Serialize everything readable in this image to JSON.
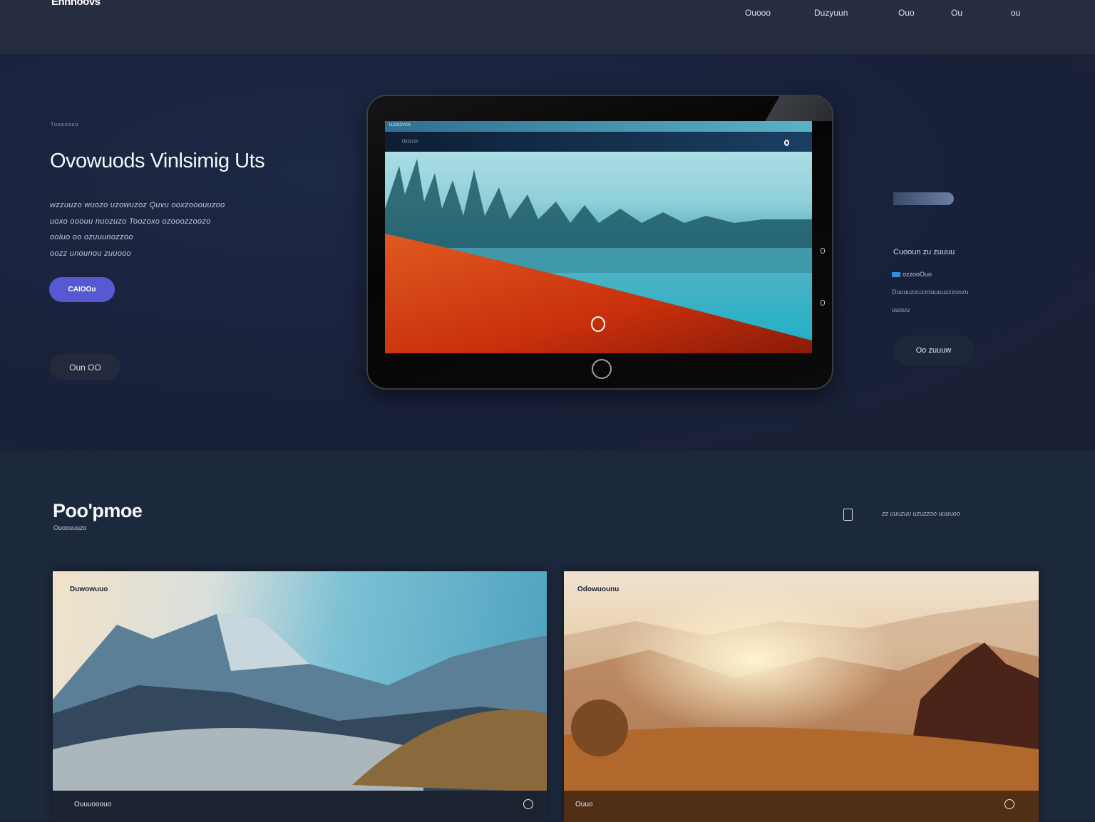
{
  "header": {
    "logo": "Ennnoovs",
    "nav": [
      "Ouooo",
      "Duzyuun",
      "Ouo",
      "Ou",
      "ou"
    ]
  },
  "hero": {
    "eyebrow": "Tuoooooo",
    "title": "Ovowuods Vinlsimig Uts",
    "paragraph": [
      "wzzuuzo wuozo uzowuzoz Quvu ooxzooouuzoo",
      "uoxo ooouu nuozuzo Toozoxo ozooozzoozo",
      "ooluo oo ozuuunozzoo",
      "oozz unounou zuuooo"
    ],
    "primary_button": "CAIOOu",
    "secondary_button": "Oun OO"
  },
  "tablet": {
    "top_bar_text": "UZOIZVXX",
    "nav_text": "Ozzzzzz"
  },
  "right_panel": {
    "label": "Cuooun zu zuuuu",
    "tag": "ozzooOuo",
    "description": [
      "Duuuuzzuzzouuuuzzzoozu",
      "uuouu"
    ],
    "button": "Oo zuuuw"
  },
  "section": {
    "title": "Poo'pmoe",
    "subtitle": "Ouoouuuzo",
    "link": "zz uuuzuu uzuzzoo uuuuoo",
    "cards": [
      {
        "label": "Duwowuuo",
        "footer": "Ouuuooouo",
        "icon": "info-icon"
      },
      {
        "label": "Odowuounu",
        "footer": "Ouuo",
        "icon": "at-icon"
      }
    ]
  },
  "colors": {
    "accent": "#5659cf",
    "header_bg": "#262d41",
    "hero_bg": "#1a2236",
    "section_bg": "#1c283b"
  }
}
